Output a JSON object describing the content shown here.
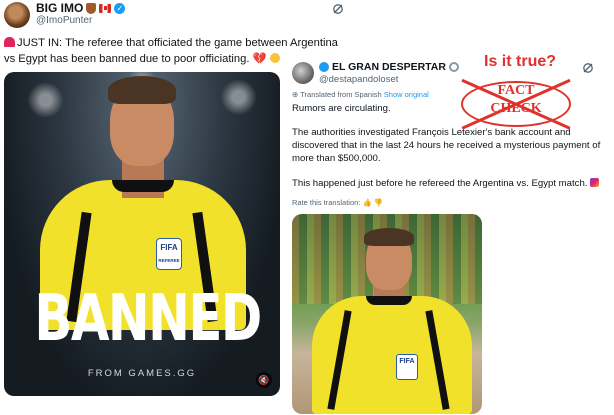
{
  "left_tweet": {
    "display_name": "BIG IMO",
    "handle": "@ImoPunter",
    "text": "JUST IN: The referee that officiated the game between Argentina vs Egypt has been banned due to poor officiating.",
    "heart_emoji": "💔",
    "media": {
      "headline": "BANNED",
      "source": "FROM GAMES.GG",
      "badge": "FIFA",
      "badge_sub": "REFEREE"
    }
  },
  "right_tweet": {
    "display_name": "EL GRAN DESPERTAR",
    "handle": "@destapandoloset",
    "translated_label": "Translated from Spanish",
    "show_original": "Show original",
    "paragraphs": [
      "Rumors are circulating.",
      "The authorities investigated François Letexier's bank account and discovered that in the last 24 hours he received a mysterious payment of more than $500,000.",
      "This happened just before he refereed the Argentina vs. Egypt match."
    ],
    "rate_label": "Rate this translation:",
    "media": {
      "badge": "FIFA"
    }
  },
  "annotation": {
    "question": "Is it true?",
    "stamp_line1": "FACT",
    "stamp_line2": "CHECK",
    "color": "#e0312b"
  },
  "colors": {
    "verified": "#1d9bf0",
    "jersey": "#f2e12b"
  },
  "icons": {
    "grok": "grok-icon",
    "mute": "mute-icon",
    "thumbs": "thumbs-up-icon"
  }
}
